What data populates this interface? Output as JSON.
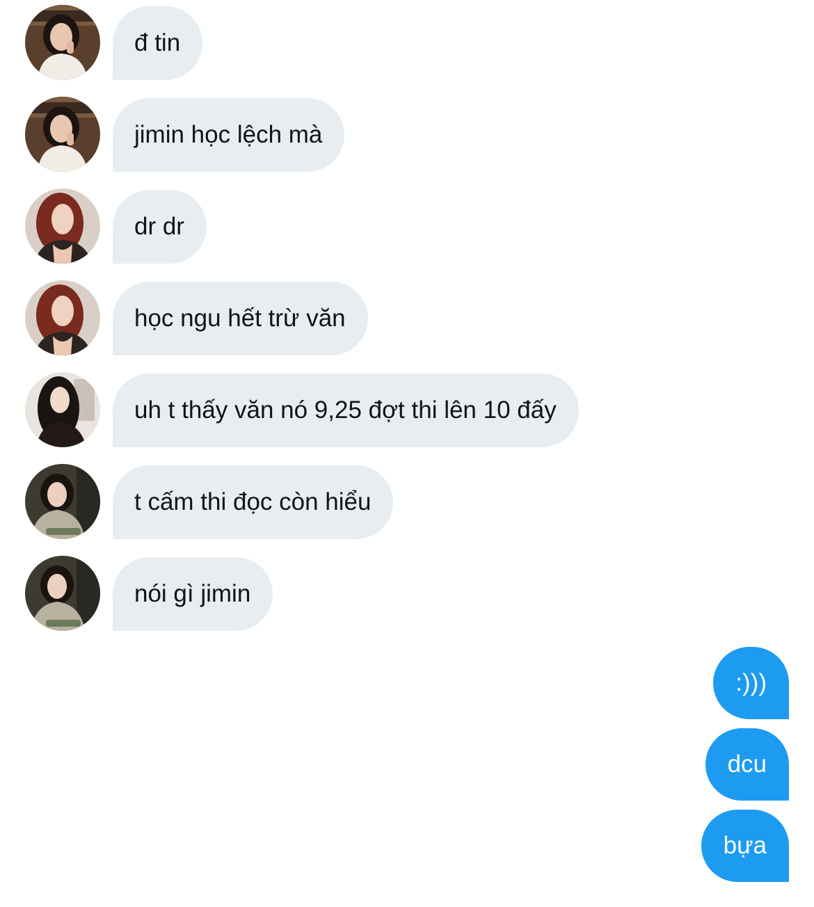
{
  "conversation": {
    "incoming": [
      {
        "avatar": "avatar-a",
        "text": "đ tin"
      },
      {
        "avatar": "avatar-a",
        "text": "jimin học lệch mà"
      },
      {
        "avatar": "avatar-b",
        "text": "dr dr"
      },
      {
        "avatar": "avatar-b",
        "text": "học ngu hết trừ văn"
      },
      {
        "avatar": "avatar-c",
        "text": "uh t thấy văn nó 9,25 đợt thi lên 10 đấy"
      },
      {
        "avatar": "avatar-d",
        "text": "t cấm thi đọc còn hiểu"
      },
      {
        "avatar": "avatar-d",
        "text": "nói gì jimin"
      }
    ],
    "outgoing": [
      {
        "text": ":)))"
      },
      {
        "text": "dcu"
      },
      {
        "text": "bựa"
      }
    ]
  },
  "colors": {
    "incoming_bubble": "#e8edf1",
    "incoming_text": "#0f1419",
    "outgoing_bubble": "#1d9bf0",
    "outgoing_text": "#ffffff"
  }
}
